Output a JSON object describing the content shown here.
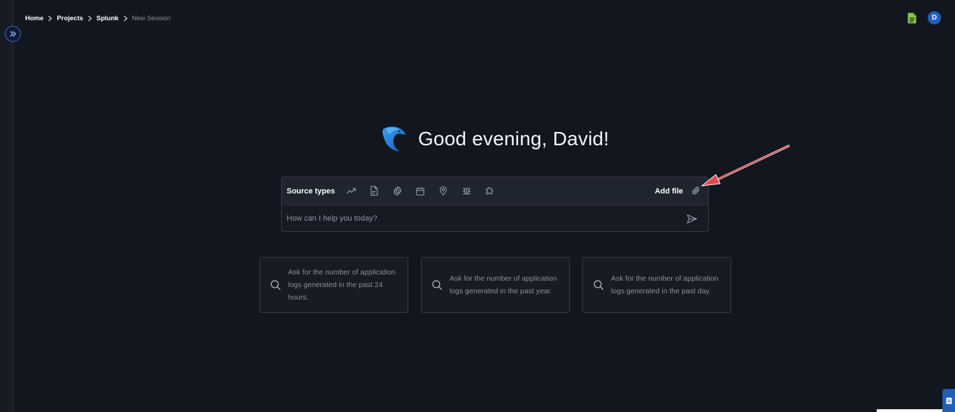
{
  "breadcrumb": {
    "items": [
      "Home",
      "Projects",
      "Splunk"
    ],
    "current": "New Session"
  },
  "user": {
    "initial": "D"
  },
  "greeting": "Good evening, David!",
  "composer": {
    "source_label": "Source types",
    "tools": [
      "trend-icon",
      "document-icon",
      "gear-icon",
      "calendar-icon",
      "location-pin-icon",
      "bug-icon",
      "puzzle-icon"
    ],
    "add_file_label": "Add file",
    "placeholder": "How can I help you today?"
  },
  "suggestions": [
    {
      "text": "Ask for the number of application logs generated in the past 24 hours."
    },
    {
      "text": "Ask for the number of application logs generated in the past year."
    },
    {
      "text": "Ask for the number of application logs generated in the past day."
    }
  ],
  "colors": {
    "background": "#12161f",
    "accent": "#1f5fb8",
    "annotation_arrow": "#e0484c",
    "doc_icon": "#8bc34a"
  }
}
